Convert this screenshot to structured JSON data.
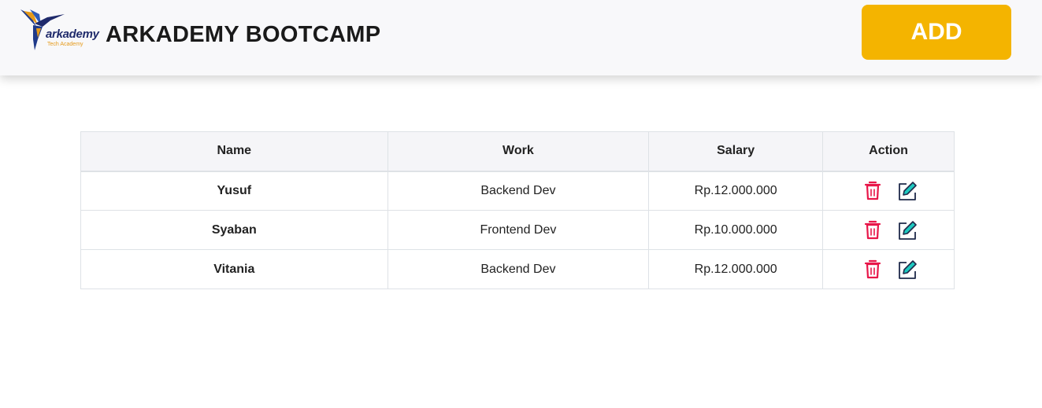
{
  "header": {
    "logo_text": "arkademy",
    "logo_subtext": "Tech Academy",
    "title": "ARKADEMY BOOTCAMP",
    "add_label": "ADD",
    "add_color": "#f4b400"
  },
  "table": {
    "columns": [
      "Name",
      "Work",
      "Salary",
      "Action"
    ],
    "rows": [
      {
        "name": "Yusuf",
        "work": "Backend Dev",
        "salary": "Rp.12.000.000"
      },
      {
        "name": "Syaban",
        "work": "Frontend Dev",
        "salary": "Rp.10.000.000"
      },
      {
        "name": "Vitania",
        "work": "Backend Dev",
        "salary": "Rp.12.000.000"
      }
    ],
    "row_actions": [
      "trash-icon",
      "edit-icon"
    ],
    "colors": {
      "delete": "#e8174a",
      "edit_frame": "#1f2a4a",
      "edit_pencil": "#1ec9c0"
    }
  }
}
